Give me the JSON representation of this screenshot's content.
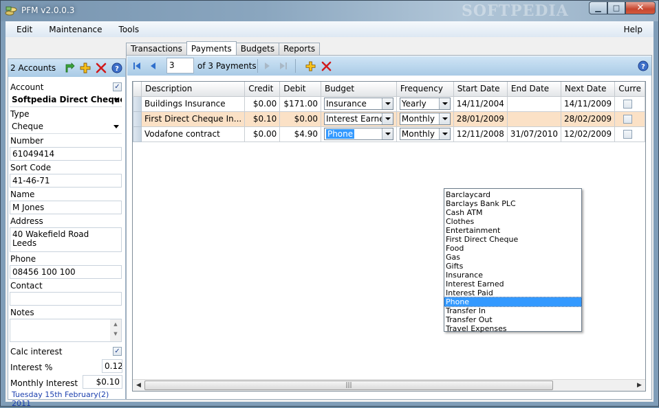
{
  "window": {
    "title": "PFM v2.0.0.3",
    "watermark": "SOFTPEDIA"
  },
  "menu": [
    "Edit",
    "Maintenance",
    "Tools"
  ],
  "menu_help": "Help",
  "accounts": {
    "title": "2 Accounts",
    "account_label": "Account",
    "account_value": "Softpedia Direct Cheque",
    "type_label": "Type",
    "type_value": "Cheque",
    "number_label": "Number",
    "number_value": "61049414",
    "sortcode_label": "Sort Code",
    "sortcode_value": "41-46-71",
    "name_label": "Name",
    "name_value": "M Jones",
    "address_label": "Address",
    "address_line1": "40 Wakefield Road",
    "address_line2": "Leeds",
    "phone_label": "Phone",
    "phone_value": "08456 100 100",
    "contact_label": "Contact",
    "contact_value": "",
    "notes_label": "Notes",
    "notes_value": "",
    "calc_interest_label": "Calc interest",
    "interest_pct_label": "Interest %",
    "interest_pct_value": "0.12",
    "monthly_interest_label": "Monthly Interest",
    "monthly_interest_value": "$0.10",
    "date": "Tuesday 15th February(2) 2011"
  },
  "tabs": [
    "Transactions",
    "Payments",
    "Budgets",
    "Reports"
  ],
  "nav": {
    "position": "3",
    "of_label": "of 3 Payments"
  },
  "grid": {
    "columns": [
      "Description",
      "Credit",
      "Debit",
      "Budget",
      "Frequency",
      "Start Date",
      "End Date",
      "Next Date",
      "Curre"
    ],
    "rows": [
      {
        "description": "Buildings Insurance",
        "credit": "$0.00",
        "debit": "$171.00",
        "budget": "Insurance",
        "frequency": "Yearly",
        "start": "14/11/2004",
        "end": "",
        "next": "14/11/2009"
      },
      {
        "description": "First Direct Cheque In...",
        "credit": "$0.10",
        "debit": "$0.00",
        "budget": "Interest Earned",
        "frequency": "Monthly",
        "start": "28/01/2009",
        "end": "",
        "next": "28/02/2009"
      },
      {
        "description": "Vodafone contract",
        "credit": "$0.00",
        "debit": "$4.90",
        "budget": "Phone",
        "frequency": "Monthly",
        "start": "12/11/2008",
        "end": "31/07/2010",
        "next": "12/02/2009"
      }
    ]
  },
  "budget_options": [
    "Barclaycard",
    "Barclays Bank PLC",
    "Cash ATM",
    "Clothes",
    "Entertainment",
    "First Direct Cheque",
    "Food",
    "Gas",
    "Gifts",
    "Insurance",
    "Interest Earned",
    "Interest Paid",
    "Phone",
    "Transfer In",
    "Transfer Out",
    "Travel Expenses"
  ],
  "colors": {
    "accent": "#3399ff",
    "alt_row": "#fbe1c6",
    "panel_header": "#a9cbe6",
    "date_text": "#1b3fae"
  }
}
